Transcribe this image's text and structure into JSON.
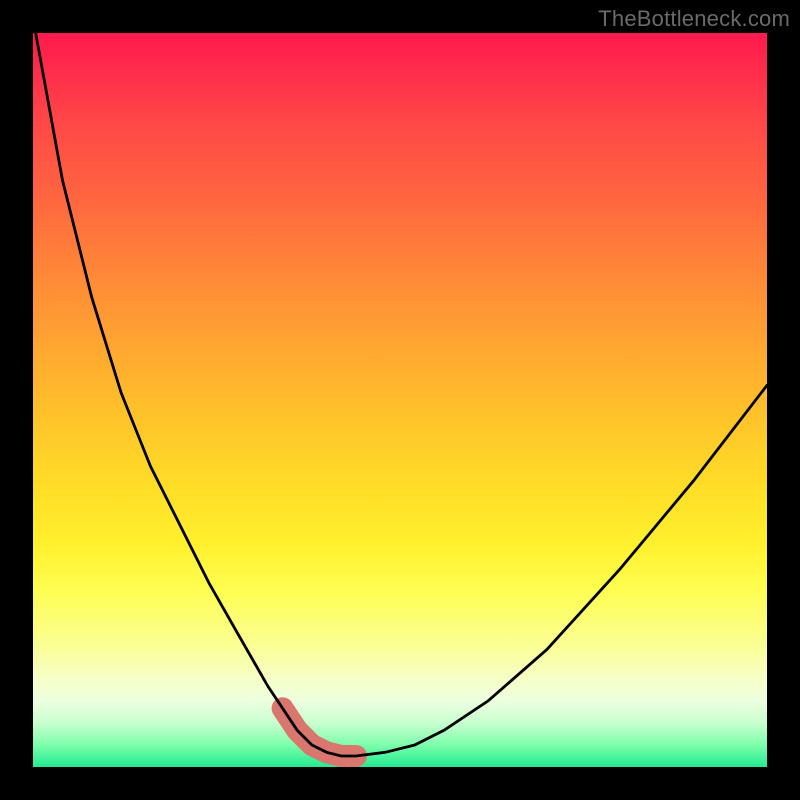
{
  "watermark": "TheBottleneck.com",
  "colors": {
    "background": "#000000",
    "watermark": "#6a6a6a",
    "curve": "#000000",
    "highlight": "#d9766e",
    "gradient_stops": [
      "#ff1a4d",
      "#ff4747",
      "#ff8538",
      "#ffc22a",
      "#fff12f",
      "#fbff90",
      "#edffe0",
      "#7dfeab",
      "#22eb92"
    ]
  },
  "chart_data": {
    "type": "line",
    "title": "",
    "xlabel": "",
    "ylabel": "",
    "xlim": [
      0,
      100
    ],
    "ylim": [
      0,
      100
    ],
    "grid": false,
    "series": [
      {
        "name": "curve",
        "x": [
          0,
          4,
          8,
          12,
          16,
          20,
          24,
          28,
          32,
          34,
          36,
          38,
          40,
          42,
          44,
          48,
          52,
          56,
          62,
          70,
          80,
          90,
          100
        ],
        "y": [
          102,
          80,
          64,
          51,
          41,
          33,
          25,
          18,
          11,
          8,
          5,
          3,
          2,
          1.5,
          1.5,
          2,
          3,
          5,
          9,
          16,
          27,
          39,
          52
        ]
      }
    ],
    "highlight_range_x": [
      33,
      47
    ],
    "note": "Values estimated from pixel positions; x is relative horizontal position (percent of inner width), y is relative height (percent of inner height from bottom). The curve is a V-shaped bottleneck profile over a vertical red-to-green gradient with a salmon highlight near the minimum."
  }
}
